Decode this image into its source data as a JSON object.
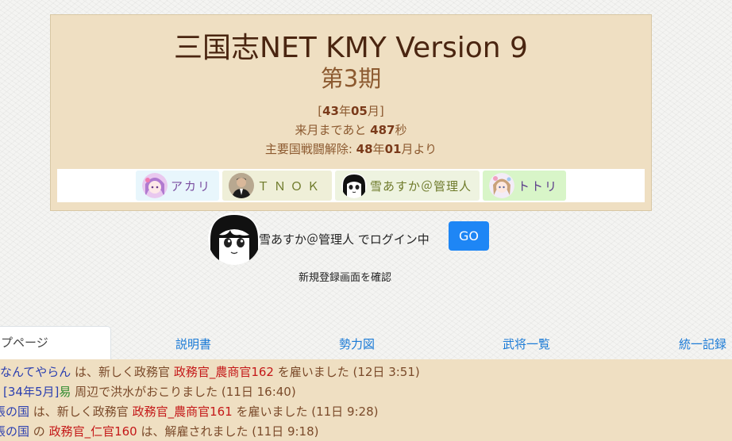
{
  "header": {
    "title": "三国志NET KMY Version 9",
    "season": "第3期",
    "date": {
      "open": "[",
      "year": "43",
      "year_unit": "年",
      "month": "05",
      "month_unit": "月",
      "close": "]"
    },
    "next_month": {
      "prefix": "来月まであと ",
      "seconds": "487",
      "unit": "秒"
    },
    "war_unlock": {
      "prefix": "主要国戦闘解除: ",
      "year": "48",
      "year_unit": "年",
      "month": "01",
      "suffix": "月より"
    }
  },
  "players": [
    {
      "name": "アカリ",
      "icon": "anime-girl-purple-avatar"
    },
    {
      "name": "ＴＮＯＫ",
      "icon": "man-dark-suit-avatar"
    },
    {
      "name": "雪あすか＠管理人",
      "icon": "manga-girl-avatar"
    },
    {
      "name": "トトリ",
      "icon": "anime-girl-pastel-avatar"
    }
  ],
  "login": {
    "user": "雪あすか＠管理人",
    "suffix": " でログイン中",
    "go_label": "GO",
    "register_label": "新規登録画面を確認"
  },
  "tabs": [
    {
      "label": "プページ",
      "active": true
    },
    {
      "label": "説明書"
    },
    {
      "label": "勢力図"
    },
    {
      "label": "武将一覧"
    },
    {
      "label": "統一記録"
    }
  ],
  "log": [
    {
      "a": "なんてやらん",
      "b": " は、新しく政務官 ",
      "c": "政務官_農商官162",
      "d": " を雇いました (12日 3:51)"
    },
    {
      "a": "[34年5月]",
      "b": "易",
      "c": " 周辺で洪水がおこりました (11日 16:40)"
    },
    {
      "a": "帳の国",
      "b": " は、新しく政務官 ",
      "c": "政務官_農商官161",
      "d": " を雇いました (11日 9:28)"
    },
    {
      "a": "帳の国",
      "b": " の ",
      "c": "政務官_仁官160",
      "d": " は、解雇されました (11日 9:18)"
    }
  ],
  "colors": {
    "header_bg": "#efdfc2",
    "title": "#4a2510",
    "accent_brown": "#8c5a30",
    "link_blue": "#1a7ad6",
    "go_button": "#1e86f5",
    "log_red": "#c41818",
    "log_name_blue": "#2b3fb0",
    "log_green": "#2e8a2e"
  }
}
